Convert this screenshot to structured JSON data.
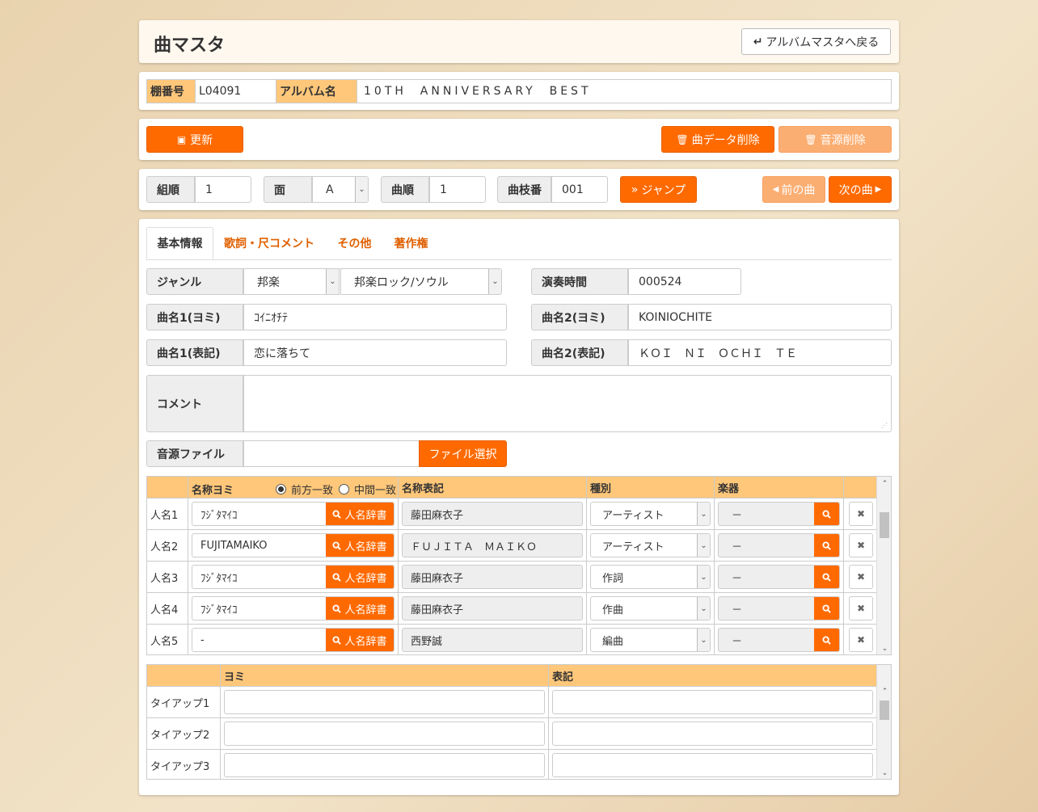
{
  "header": {
    "title": "曲マスタ",
    "back_label": "アルバムマスタへ戻る"
  },
  "album": {
    "shelf_label": "棚番号",
    "shelf_value": "L04091",
    "album_label": "アルバム名",
    "album_value": "10TH  ANNIVERSARY  BEST"
  },
  "actions": {
    "update": "更新",
    "delete_song": "曲データ削除",
    "delete_source": "音源削除"
  },
  "nav": {
    "group_label": "組順",
    "group_value": "1",
    "side_label": "面",
    "side_value": "A",
    "track_label": "曲順",
    "track_value": "1",
    "branch_label": "曲枝番",
    "branch_value": "001",
    "jump": "ジャンプ",
    "prev": "前の曲",
    "next": "次の曲"
  },
  "tabs": [
    "基本情報",
    "歌詞・尺コメント",
    "その他",
    "著作権"
  ],
  "form": {
    "genre_label": "ジャンル",
    "genre1": "邦楽",
    "genre2": "邦楽ロック/ソウル",
    "duration_label": "演奏時間",
    "duration_value": "000524",
    "title1_yomi_label": "曲名1(ヨミ)",
    "title1_yomi": "ｺｲﾆｵﾁﾃ",
    "title2_yomi_label": "曲名2(ヨミ)",
    "title2_yomi": "KOINIOCHITE",
    "title1_label": "曲名1(表記)",
    "title1": "恋に落ちて",
    "title2_label": "曲名2(表記)",
    "title2": "ＫＯＩ　ＮＩ　ＯＣＨＩ　ＴＥ",
    "comment_label": "コメント",
    "comment": "",
    "file_label": "音源ファイル",
    "file_value": "",
    "file_button": "ファイル選択"
  },
  "people": {
    "headers": {
      "yomi": "名称ヨミ",
      "match_prefix": "前方一致",
      "match_middle": "中間一致",
      "display": "名称表記",
      "type": "種別",
      "instrument": "楽器"
    },
    "dict_label": "人名辞書",
    "rows": [
      {
        "label": "人名1",
        "yomi": "ﾌｼﾞﾀﾏｲｺ",
        "display": "藤田麻衣子",
        "type": "アーティスト",
        "instrument": "－"
      },
      {
        "label": "人名2",
        "yomi": "FUJITAMAIKO",
        "display": "ＦＵＪＩＴＡ　ＭＡＩＫＯ",
        "type": "アーティスト",
        "instrument": "－"
      },
      {
        "label": "人名3",
        "yomi": "ﾌｼﾞﾀﾏｲｺ",
        "display": "藤田麻衣子",
        "type": "作詞",
        "instrument": "－"
      },
      {
        "label": "人名4",
        "yomi": "ﾌｼﾞﾀﾏｲｺ",
        "display": "藤田麻衣子",
        "type": "作曲",
        "instrument": "－"
      },
      {
        "label": "人名5",
        "yomi": "-",
        "display": "西野誠",
        "type": "編曲",
        "instrument": "－"
      }
    ]
  },
  "tieup": {
    "headers": {
      "yomi": "ヨミ",
      "display": "表記"
    },
    "rows": [
      {
        "label": "タイアップ1",
        "yomi": "",
        "display": ""
      },
      {
        "label": "タイアップ2",
        "yomi": "",
        "display": ""
      },
      {
        "label": "タイアップ3",
        "yomi": "",
        "display": ""
      }
    ]
  },
  "colors": {
    "accent": "#ff6a00",
    "accent_light": "#fbae72",
    "header": "#ffc77a",
    "tab_text": "#e06000"
  }
}
